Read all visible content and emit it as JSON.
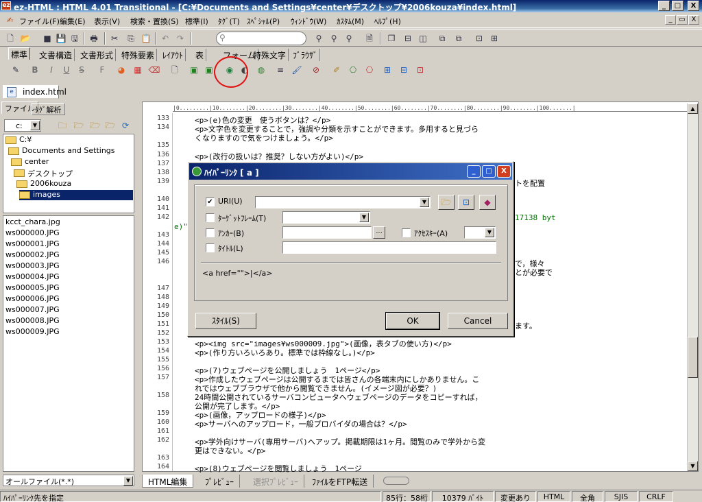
{
  "app": {
    "title": "ez-HTML : HTML 4.01 Transitional - [C:¥Documents and Settings¥center¥デスクトップ¥2006kouza¥index.html]",
    "icon_label": "ez"
  },
  "window_buttons": {
    "minimize": "_",
    "maximize": "□",
    "close": "X"
  },
  "menu": [
    "ファイル(F)",
    "編集(E)",
    "表示(V)",
    "検索・置換(S)",
    "標準(I)",
    "ﾀｸﾞ(T)",
    "ｽﾍﾟｼｬﾙ(P)",
    "ｳｨﾝﾄﾞｳ(W)",
    "ｶｽﾀﾑ(M)",
    "ﾍﾙﾌﾟ(H)"
  ],
  "mdi_buttons": {
    "minimize": "_",
    "restore": "▭",
    "close": "X"
  },
  "toolbar_tabs": [
    "標準",
    "文書構造",
    "文書形式",
    "特殊要素",
    "ﾚｲｱｳﾄ",
    "表",
    "フォーム",
    "特殊文字",
    "ﾌﾞﾗｳｻﾞ"
  ],
  "document_tab": {
    "label": "index.html"
  },
  "left_tabs": [
    "ファイル",
    "ﾀｸﾞ解析"
  ],
  "drive": {
    "value": "c:"
  },
  "tree": [
    {
      "label": "C:¥"
    },
    {
      "label": "Documents and Settings"
    },
    {
      "label": "center"
    },
    {
      "label": "デスクトップ"
    },
    {
      "label": "2006kouza"
    },
    {
      "label": "images"
    }
  ],
  "files": [
    "kcct_chara.jpg",
    "ws000000.JPG",
    "ws000001.JPG",
    "ws000002.JPG",
    "ws000003.JPG",
    "ws000004.JPG",
    "ws000005.JPG",
    "ws000006.JPG",
    "ws000007.JPG",
    "ws000008.JPG",
    "ws000009.JPG"
  ],
  "file_filter": {
    "value": "オールファイル(*.*)"
  },
  "ruler_text": "|0.........|10........|20........|30........|40........|50........|60........|70........|80........|90........|100.......|",
  "line_numbers": [
    "133",
    "134",
    "135",
    "136",
    "137",
    "138",
    "139",
    "140",
    "141",
    "142",
    "143",
    "144",
    "145",
    "146",
    "147",
    "148",
    "149",
    "150",
    "151",
    "152",
    "153",
    "154",
    "155",
    "156",
    "157",
    "158",
    "159",
    "160",
    "161",
    "162",
    "163",
    "164"
  ],
  "code": {
    "l133": "<p>(e)色の変更　使うボタンは？</p>",
    "l134a": "<p>文字色を変更することで，強調や分類を示すことができます。多用すると見づら",
    "l134b": "くなりますので気をつけましょう。</p>",
    "l136": "<p>(改行の扱いは？推奨？しない方がよい)</p>",
    "l139_frag": "トを配置",
    "l142_frag": "17138 byt",
    "l142_wrap": "e)\"",
    "l146a_frag": "で，様々",
    "l146b_frag": "とが必要で",
    "l151_frag": "ます。",
    "l153": "<p><img src=\"images¥ws000009.jpg\">(画像，表タブの使い方)</p>",
    "l154": "<p>(作り方いろいろあり。標準では枠線なし。)</p>",
    "l156": "<p>(7)ウェブページを公開しましょう　1ページ</p>",
    "l157a": "<p>作成したウェブページは公開するまでは皆さんの各端末内にしかありません。こ",
    "l157b": "れではウェブブラウザで他から閲覧できません。(イメージ図が必要？)",
    "l158a": "24時間公開されているサーバコンピュータへウェブページのデータをコピーすれば，",
    "l158b": "公開が完了します。</p>",
    "l159": "<p>(画像，アップロードの様子)</p>",
    "l160": "<p>サーバへのアップロード，一般プロバイダの場合は？</p>",
    "l162a": "<p>学外向けサーバ(専用サーバ)へアップ。掲載期限は1ヶ月。閲覧のみで学外から変",
    "l162b": "更はできない。</p>",
    "l164": "<p>(8)ウェブページを閲覧しましょう　1ページ"
  },
  "bottom_tabs": [
    "HTML編集",
    "ﾌﾟﾚﾋﾞｭｰ",
    "選択ﾌﾟﾚﾋﾞｭｰ",
    "ﾌｧｲﾙをFTP転送"
  ],
  "status": {
    "message": "ﾊｲﾊﾟｰﾘﾝｸ先を指定",
    "position": "85行：58桁",
    "bytes": "10379 ﾊﾞｲﾄ",
    "modified": "変更あり",
    "mode": "HTML",
    "width": "全角",
    "encoding": "SJIS",
    "newline": "CRLF"
  },
  "dialog": {
    "title": "ﾊｲﾊﾟｰﾘﾝｸ [ a ]",
    "uri_label": "URI(U)",
    "uri_checked": true,
    "uri_value": "",
    "target_label": "ﾀｰｹﾞｯﾄﾌﾚｰﾑ(T)",
    "target_value": "",
    "anchor_label": "ｱﾝｶｰ(B)",
    "anchor_value": "",
    "browse_anchor": "...",
    "accesskey_label": "ｱｸｾｽｷｰ(A)",
    "accesskey_value": "",
    "title_label": "ﾀｲﾄﾙ(L)",
    "title_value": "",
    "preview": "<a href=\"\">|</a>",
    "style_button": "ｽﾀｲﾙ(S)",
    "ok_button": "OK",
    "cancel_button": "Cancel"
  },
  "colors": {
    "highlight_circle": "#e01010",
    "titlebar": "#0a246a",
    "tag": "#00007a"
  }
}
